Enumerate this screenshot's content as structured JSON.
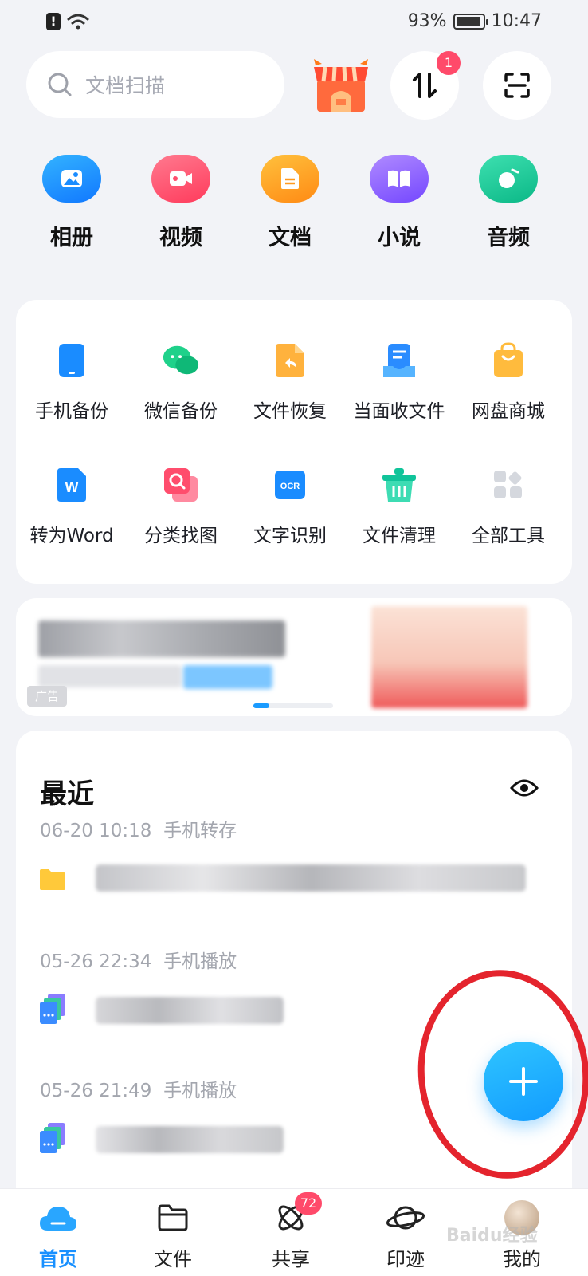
{
  "status_bar": {
    "battery": "93%",
    "battery_level": 0.93,
    "time": "10:47"
  },
  "search": {
    "placeholder": "文档扫描"
  },
  "header": {
    "transfer_badge": "1"
  },
  "categories": [
    {
      "label": "相册",
      "icon": "image-icon",
      "color": "#1a8cff"
    },
    {
      "label": "视频",
      "icon": "video-icon",
      "color": "#ff4d6d"
    },
    {
      "label": "文档",
      "icon": "document-icon",
      "color": "#ff9a1f"
    },
    {
      "label": "小说",
      "icon": "book-icon",
      "color": "#8a5cff"
    },
    {
      "label": "音频",
      "icon": "music-icon",
      "color": "#13c493"
    }
  ],
  "tools": [
    {
      "label": "手机备份",
      "icon": "phone-backup-icon"
    },
    {
      "label": "微信备份",
      "icon": "wechat-backup-icon"
    },
    {
      "label": "文件恢复",
      "icon": "file-restore-icon"
    },
    {
      "label": "当面收文件",
      "icon": "receive-file-icon"
    },
    {
      "label": "网盘商城",
      "icon": "shopping-bag-icon"
    },
    {
      "label": "转为Word",
      "icon": "word-convert-icon"
    },
    {
      "label": "分类找图",
      "icon": "image-search-icon"
    },
    {
      "label": "文字识别",
      "icon": "ocr-icon"
    },
    {
      "label": "文件清理",
      "icon": "clean-basket-icon"
    },
    {
      "label": "全部工具",
      "icon": "all-tools-icon"
    }
  ],
  "ad": {
    "tag": "广告"
  },
  "recent": {
    "title": "最近",
    "groups": [
      {
        "time": "06-20 10:18",
        "source": "手机转存"
      },
      {
        "time": "05-26 22:34",
        "source": "手机播放"
      },
      {
        "time": "05-26 21:49",
        "source": "手机播放"
      }
    ]
  },
  "nav": [
    {
      "label": "首页",
      "icon": "cloud-home-icon",
      "active": true
    },
    {
      "label": "文件",
      "icon": "folder-icon"
    },
    {
      "label": "共享",
      "icon": "share-orbit-icon",
      "badge": "72"
    },
    {
      "label": "印迹",
      "icon": "planet-icon"
    },
    {
      "label": "我的",
      "icon": "avatar"
    }
  ],
  "watermark": "Baidu经验"
}
